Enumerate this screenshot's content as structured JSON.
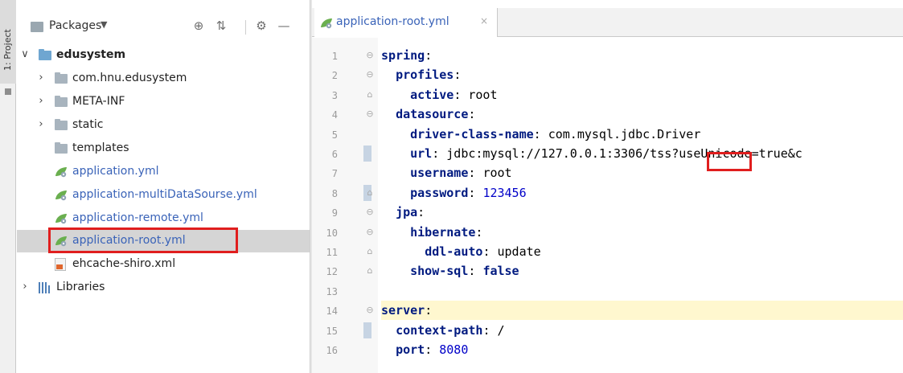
{
  "side_strip": {
    "tab_label": "1: Project"
  },
  "project_panel": {
    "title": "Packages",
    "title_arrow": "▼",
    "header_icons": [
      "target-icon",
      "collapse-icon",
      "gear-icon",
      "minimize-icon"
    ],
    "tree": [
      {
        "label": "edusystem",
        "kind": "module",
        "depth": 0,
        "expanded": true
      },
      {
        "label": "com.hnu.edusystem",
        "kind": "folder",
        "depth": 1,
        "expanded": false
      },
      {
        "label": "META-INF",
        "kind": "folder",
        "depth": 1,
        "expanded": false
      },
      {
        "label": "static",
        "kind": "folder",
        "depth": 1,
        "expanded": false
      },
      {
        "label": "templates",
        "kind": "folder",
        "depth": 1,
        "expanded": null
      },
      {
        "label": "application.yml",
        "kind": "yml",
        "depth": 1
      },
      {
        "label": "application-multiDataSourse.yml",
        "kind": "yml",
        "depth": 1
      },
      {
        "label": "application-remote.yml",
        "kind": "yml",
        "depth": 1
      },
      {
        "label": "application-root.yml",
        "kind": "yml",
        "depth": 1,
        "selected": true
      },
      {
        "label": "ehcache-shiro.xml",
        "kind": "xml",
        "depth": 1
      },
      {
        "label": "Libraries",
        "kind": "library",
        "depth": 0,
        "expanded": false
      }
    ]
  },
  "editor": {
    "tab": {
      "label": "application-root.yml",
      "close": "×"
    },
    "lines": [
      {
        "n": "1",
        "key": "spring",
        "sep": ":",
        "value": ""
      },
      {
        "n": "2",
        "key": "profiles",
        "sep": ":",
        "value": ""
      },
      {
        "n": "3",
        "key": "active",
        "sep": ": ",
        "value": "root"
      },
      {
        "n": "4",
        "key": "datasource",
        "sep": ":",
        "value": ""
      },
      {
        "n": "5",
        "key": "driver-class-name",
        "sep": ": ",
        "value": "com.mysql.jdbc.Driver"
      },
      {
        "n": "6",
        "key": "url",
        "sep": ": ",
        "value": "jdbc:mysql://127.0.0.1:3306/tss?useUnicode=true&c"
      },
      {
        "n": "7",
        "key": "username",
        "sep": ": ",
        "value": "root"
      },
      {
        "n": "8",
        "key": "password",
        "sep": ": ",
        "value": "123456"
      },
      {
        "n": "9",
        "key": "jpa",
        "sep": ":",
        "value": ""
      },
      {
        "n": "10",
        "key": "hibernate",
        "sep": ":",
        "value": ""
      },
      {
        "n": "11",
        "key": "ddl-auto",
        "sep": ": ",
        "value": "update"
      },
      {
        "n": "12",
        "key": "show-sql",
        "sep": ": ",
        "value": "false"
      },
      {
        "n": "13",
        "key": "",
        "sep": "",
        "value": ""
      },
      {
        "n": "14",
        "key": "server",
        "sep": ":",
        "value": ""
      },
      {
        "n": "15",
        "key": "context-path",
        "sep": ": ",
        "value": "/"
      },
      {
        "n": "16",
        "key": "port",
        "sep": ": ",
        "value": "8080"
      }
    ]
  },
  "colors": {
    "highlight_box": "#e01e1e",
    "yml_file": "#3a63b8",
    "yaml_key": "#001a80",
    "yaml_number": "#0000c8",
    "selected_row": "#d5d5d5",
    "caret_line": "#fff7cf"
  }
}
